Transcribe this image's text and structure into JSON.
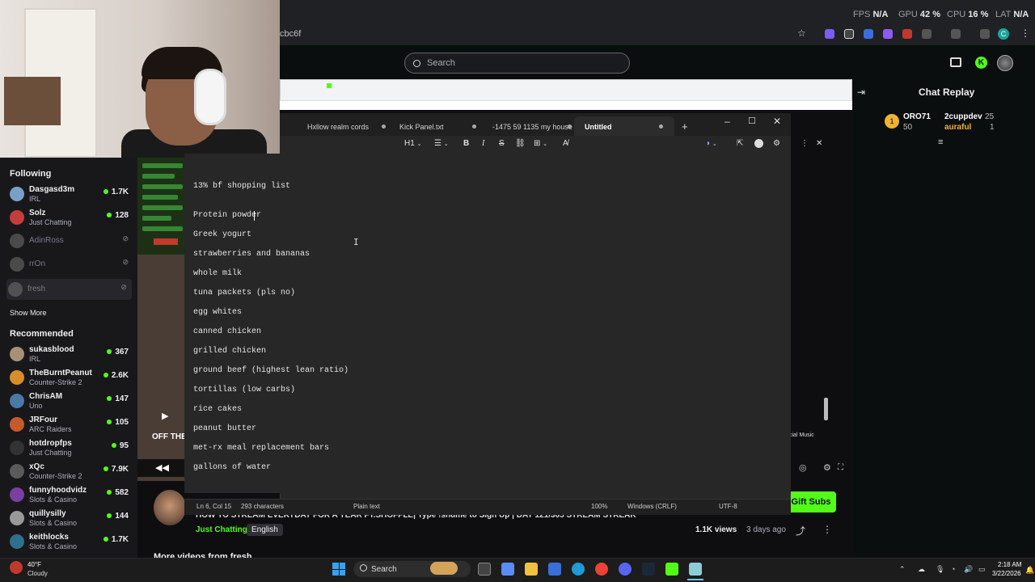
{
  "browser": {
    "url_fragment": "cbc6f",
    "perf": {
      "fps_label": "FPS",
      "fps_value": "N/A",
      "gpu_label": "GPU",
      "gpu_value": "42 %",
      "cpu_label": "CPU",
      "cpu_value": "16 %",
      "lat_label": "LAT",
      "lat_value": "N/A"
    },
    "profile_initial": "C"
  },
  "kick": {
    "search_placeholder": "Search",
    "sidebar": {
      "following_title": "Following",
      "following": [
        {
          "name": "Dasgasd3m",
          "category": "IRL",
          "viewers": "1.7K",
          "color": "#7aa0c8",
          "online": true
        },
        {
          "name": "Solz",
          "category": "Just Chatting",
          "viewers": "128",
          "color": "#c43d3d",
          "online": true
        },
        {
          "name": "AdinRoss",
          "category": "",
          "viewers": "",
          "color": "#888888",
          "online": false
        },
        {
          "name": "rrOn",
          "category": "",
          "viewers": "",
          "color": "#888888",
          "online": false
        },
        {
          "name": "fresh",
          "category": "",
          "viewers": "",
          "color": "#888888",
          "online": false
        }
      ],
      "show_more": "Show More",
      "recommended_title": "Recommended",
      "recommended": [
        {
          "name": "sukasblood",
          "category": "IRL",
          "viewers": "367",
          "color": "#a89078"
        },
        {
          "name": "TheBurntPeanut",
          "category": "Counter-Strike 2",
          "viewers": "2.6K",
          "color": "#d98c2b"
        },
        {
          "name": "ChrisAM",
          "category": "Uno",
          "viewers": "147",
          "color": "#4c78a8"
        },
        {
          "name": "JRFour",
          "category": "ARC Raiders",
          "viewers": "105",
          "color": "#c65a2a"
        },
        {
          "name": "hotdropfps",
          "category": "Just Chatting",
          "viewers": "95",
          "color": "#333333"
        },
        {
          "name": "xQc",
          "category": "Counter-Strike 2",
          "viewers": "7.9K",
          "color": "#5a5a5a"
        },
        {
          "name": "funnyhoodvidz",
          "category": "Slots & Casino",
          "viewers": "582",
          "color": "#7a3fa0"
        },
        {
          "name": "quillysilly",
          "category": "Slots & Casino",
          "viewers": "144",
          "color": "#999999"
        },
        {
          "name": "keithlocks",
          "category": "Slots & Casino",
          "viewers": "1.7K",
          "color": "#2f6f8f"
        }
      ]
    },
    "stream": {
      "overlay_text": "OFF THE",
      "title": "HOW TO STREAM EVERYDAY FOR A YEAR FT.SHOFFLE| Type !shume to Sign Up | DAY 121/365 STREAM STREAK",
      "category": "Just Chatting",
      "language": "English",
      "views": "1.1K views",
      "ago": "3 days ago",
      "more_videos": "More videos from fresh",
      "gift_subs": "Gift Subs"
    },
    "chat": {
      "title": "Chat Replay",
      "leaderboard": [
        {
          "name": "ORO71",
          "value": "50",
          "color": "#ffffff"
        },
        {
          "name": "2cuppdev",
          "value": "25",
          "color": "#ffffff"
        },
        {
          "name": "auraful",
          "value": "1",
          "color": "#f0b232"
        }
      ]
    }
  },
  "notepad": {
    "tabs": [
      "Hxllow realm cords",
      "Kick Panel.txt",
      "-1475 59 1135 my house",
      "Untitled"
    ],
    "toolbar": {
      "heading": "H1"
    },
    "lines": [
      "13% bf shopping list",
      "",
      "Protein powder",
      "Greek yogurt",
      "strawberries and bananas",
      "whole milk",
      "tuna packets (pls no)",
      "egg whites",
      "canned chicken",
      "grilled chicken",
      "ground beef (highest lean ratio)",
      "tortillas (low carbs)",
      "rice cakes",
      "peanut butter",
      "met-rx meal replacement bars",
      "gallons of water"
    ],
    "status": {
      "position": "Ln 6, Col 15",
      "chars": "293 characters",
      "format": "Plain text",
      "zoom": "100%",
      "eol": "Windows (CRLF)",
      "encoding": "UTF-8"
    }
  },
  "taskbar": {
    "weather_temp": "40°F",
    "weather_cond": "Cloudy",
    "search": "Search",
    "time": "2:18 AM",
    "date": "3/22/2026"
  }
}
